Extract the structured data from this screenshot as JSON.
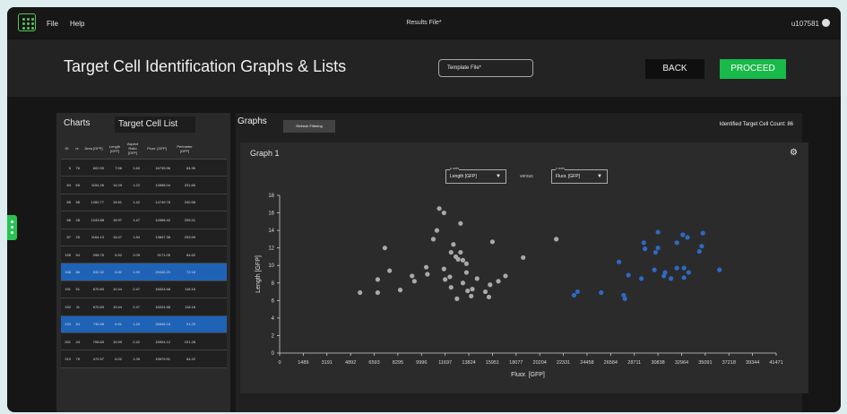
{
  "menubar": {
    "file": "File",
    "help": "Help",
    "title": "Results File*",
    "user": "u107581"
  },
  "header": {
    "title": "Target Cell Identification Graphs & Lists",
    "template_placeholder": "Template File*",
    "back": "BACK",
    "proceed": "PROCEED"
  },
  "left_panel": {
    "tabs": [
      "Charts",
      "Target Cell List"
    ],
    "columns": [
      "ID",
      "nr",
      "Area\n[GFP]",
      "Length\n[GFP]",
      "Aspect\nRatio\n[GFP]",
      "Fluor.\n[GFP]",
      "Perimeter\n[GFP]"
    ],
    "rows": [
      [
        "5",
        "76",
        "602.93",
        "7.56",
        "1.60",
        "16739.96",
        "84.96"
      ],
      [
        "84",
        "65",
        "1154.26",
        "14.09",
        "1.22",
        "14558.04",
        "231.66"
      ],
      [
        "85",
        "58",
        "1282.77",
        "15.81",
        "1.42",
        "14749.78",
        "240.58"
      ],
      [
        "86",
        "28",
        "1243.88",
        "15.97",
        "1.47",
        "14968.42",
        "239.21"
      ],
      [
        "87",
        "25",
        "1164.13",
        "16.47",
        "1.84",
        "13847.38",
        "233.59"
      ],
      [
        "155",
        "54",
        "298.75",
        "6.92",
        "2.09",
        "9171.05",
        "64.62"
      ],
      [
        "168",
        "86",
        "532.32",
        "6.82",
        "1.90",
        "29442.20",
        "72.18"
      ],
      [
        "191",
        "51",
        "670.83",
        "10.44",
        "2.47",
        "16024.68",
        "118.16"
      ],
      [
        "192",
        "11",
        "670.83",
        "10.44",
        "2.47",
        "16024.68",
        "118.16"
      ],
      [
        "193",
        "84",
        "730.58",
        "6.91",
        "1.40",
        "26848.18",
        "91.29"
      ],
      [
        "201",
        "43",
        "708.83",
        "10.99",
        "2.42",
        "15904.12",
        "101.28"
      ],
      [
        "210",
        "79",
        "472.57",
        "6.02",
        "1.39",
        "19679.91",
        "64.22"
      ]
    ],
    "selected_rows": [
      6,
      9
    ]
  },
  "right_panel": {
    "title": "Graphs",
    "refresh": "Refresh Filtering",
    "count": "Identified Target Cell Count: 86",
    "graph": {
      "name": "Graph 1",
      "y_axis_caption": "y axis",
      "y_axis_value": "Length [GFP]",
      "versus": "versus",
      "x_axis_caption": "x axis",
      "x_axis_value": "Fluor. [GFP]"
    }
  },
  "colors": {
    "accent": "#19b94a",
    "selected": "#1f63b7",
    "grey_points": "#a9a9a9",
    "blue_points": "#2e6ac4"
  },
  "chart_data": {
    "type": "scatter",
    "xlabel": "Fluor. [GFP]",
    "ylabel": "Length [GFP]",
    "xticks": [
      "0",
      "1489",
      "3191",
      "4892",
      "6593",
      "8295",
      "9996",
      "11697",
      "13824",
      "15951",
      "18077",
      "20204",
      "22331",
      "24458",
      "26584",
      "28711",
      "30838",
      "32964",
      "35091",
      "37218",
      "39344",
      "41471"
    ],
    "yticks": [
      "0",
      "2",
      "4",
      "6",
      "8",
      "10",
      "12",
      "14",
      "16",
      "18"
    ],
    "xlim": [
      0,
      42000
    ],
    "ylim": [
      0,
      18
    ],
    "grid": false,
    "series": [
      {
        "values": [
          [
            6800,
            6.9
          ],
          [
            8295,
            6.9
          ],
          [
            8295,
            8.4
          ],
          [
            8900,
            12
          ],
          [
            9300,
            9.4
          ],
          [
            10200,
            7.2
          ],
          [
            11200,
            8.8
          ],
          [
            11400,
            8.2
          ],
          [
            12400,
            9.8
          ],
          [
            12500,
            9.0
          ],
          [
            13000,
            13.0
          ],
          [
            13300,
            14.0
          ],
          [
            13500,
            16.5
          ],
          [
            13900,
            16.0
          ],
          [
            13900,
            9.6
          ],
          [
            14400,
            8.7
          ],
          [
            14500,
            11.5
          ],
          [
            14900,
            11.0
          ],
          [
            14700,
            12.4
          ],
          [
            15300,
            11.5
          ],
          [
            15300,
            14.8
          ],
          [
            15100,
            10.7
          ],
          [
            15500,
            10.6
          ],
          [
            15800,
            10.2
          ],
          [
            15800,
            9.2
          ],
          [
            15500,
            8.0
          ],
          [
            15900,
            7.1
          ],
          [
            16300,
            7.3
          ],
          [
            16700,
            8.5
          ],
          [
            16200,
            6.5
          ],
          [
            17400,
            7.0
          ],
          [
            17700,
            6.4
          ],
          [
            17800,
            7.8
          ],
          [
            18000,
            12.7
          ],
          [
            18500,
            8.2
          ],
          [
            19100,
            8.8
          ],
          [
            20600,
            10.9
          ],
          [
            23400,
            13.0
          ],
          [
            14000,
            8.4
          ],
          [
            14500,
            7.5
          ],
          [
            15000,
            6.2
          ]
        ]
      },
      {
        "values": [
          [
            24900,
            6.6
          ],
          [
            25200,
            7.0
          ],
          [
            27200,
            6.9
          ],
          [
            28700,
            10.4
          ],
          [
            29100,
            6.6
          ],
          [
            29200,
            6.2
          ],
          [
            29500,
            8.9
          ],
          [
            30600,
            8.5
          ],
          [
            30900,
            11.9
          ],
          [
            30800,
            12.6
          ],
          [
            31700,
            9.5
          ],
          [
            31800,
            11.5
          ],
          [
            32000,
            12.0
          ],
          [
            32500,
            8.8
          ],
          [
            32000,
            13.8
          ],
          [
            33100,
            8.5
          ],
          [
            33600,
            9.7
          ],
          [
            33600,
            12.6
          ],
          [
            34100,
            13.5
          ],
          [
            34200,
            9.7
          ],
          [
            34600,
            9.2
          ],
          [
            34500,
            13.2
          ],
          [
            35500,
            11.6
          ],
          [
            35700,
            12.2
          ],
          [
            35800,
            13.7
          ],
          [
            37200,
            9.5
          ],
          [
            34200,
            8.6
          ],
          [
            32600,
            9.2
          ]
        ]
      }
    ]
  }
}
